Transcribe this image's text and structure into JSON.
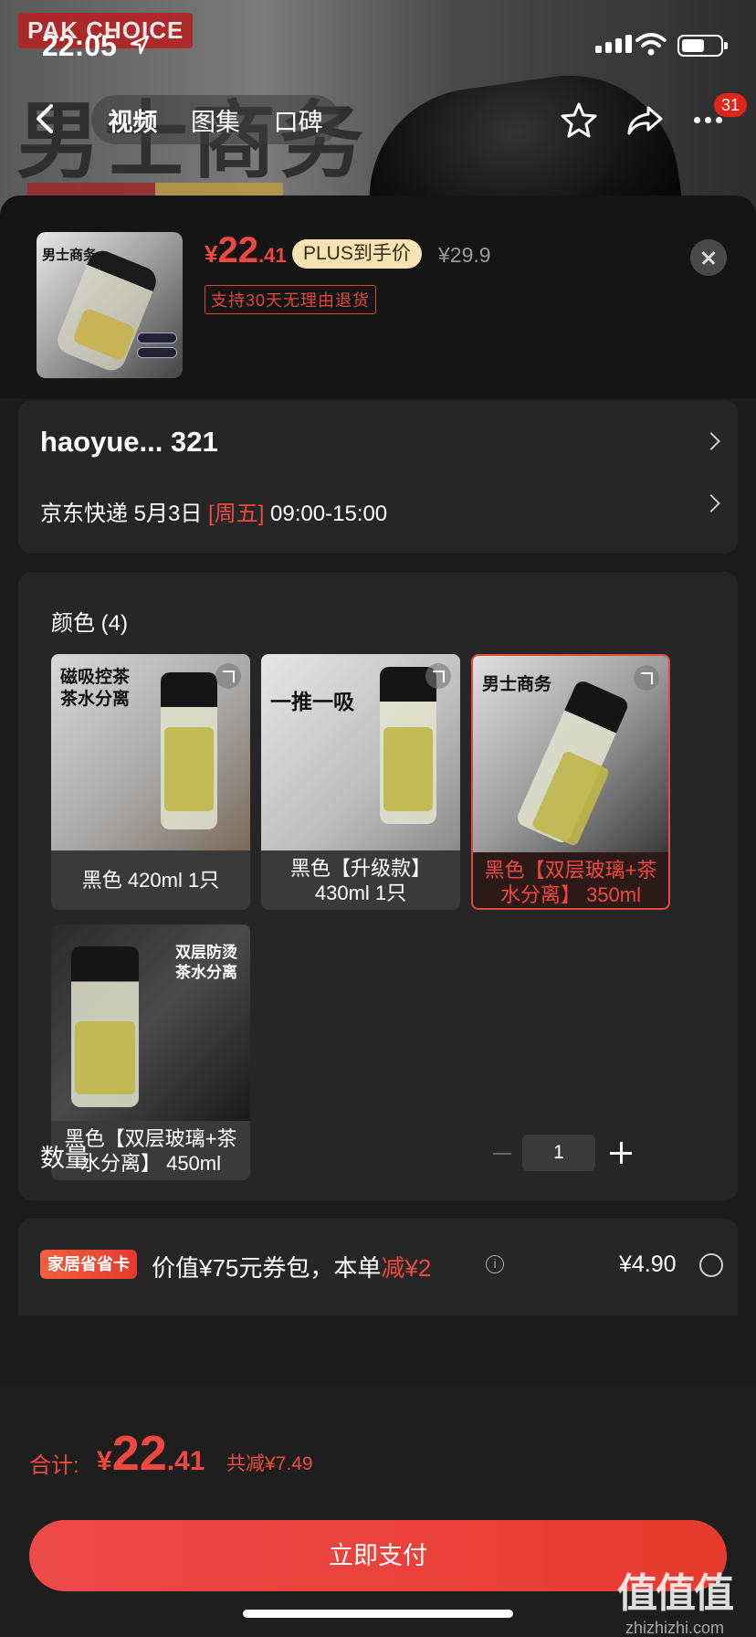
{
  "status_bar": {
    "time": "22:05"
  },
  "background": {
    "logo_text": "PAK CHOICE",
    "big_title": "男士商务"
  },
  "nav": {
    "tabs": [
      {
        "label": "视频"
      },
      {
        "label": "图集"
      },
      {
        "label": "口碑"
      }
    ],
    "badge_count": "31"
  },
  "product": {
    "thumb_caption": "男士商务",
    "thumb_pills": [
      "双层防烫",
      "茶水分离"
    ],
    "price_currency": "¥",
    "price_int": "22",
    "price_dec": ".41",
    "plus_tag": "PLUS到手价",
    "original_price": "¥29.9",
    "return_policy": "支持30天无理由退货"
  },
  "address": {
    "name": "haoyue...  321",
    "delivery_prefix": "京东快递 5月3日 ",
    "delivery_day": "[周五]",
    "delivery_time": " 09:00-15:00"
  },
  "options": {
    "title": "颜色 (4)",
    "variants": [
      {
        "label": "黑色 420ml 1只",
        "caption": "磁吸控茶\n茶水分离",
        "selected": false
      },
      {
        "label": "黑色【升级款】430ml 1只",
        "caption": "一推一吸",
        "selected": false
      },
      {
        "label": "黑色【双层玻璃+茶水分离】 350ml",
        "caption": "男士商务",
        "selected": true
      },
      {
        "label": "黑色【双层玻璃+茶水分离】 450ml",
        "caption": "双层防烫\n茶水分离",
        "selected": false
      }
    ],
    "quantity_label": "数量",
    "quantity_value": "1"
  },
  "coupon": {
    "tag": "家居省省卡",
    "text_prefix": "价值¥75元券包，本单",
    "text_highlight": "减¥2",
    "price": "¥4.90"
  },
  "footer": {
    "total_label": "合计:",
    "total_currency": "¥",
    "total_int": "22",
    "total_dec": ".41",
    "total_saved": "共减¥7.49",
    "pay_label": "立即支付"
  },
  "watermark": {
    "big": "值值值",
    "small": "zhizhizhi.com"
  },
  "colors": {
    "accent": "#f0483e",
    "sheet_bg": "#1b1b1b",
    "card_bg": "#262626",
    "plus_tag_bg": "#f5e3b3"
  }
}
